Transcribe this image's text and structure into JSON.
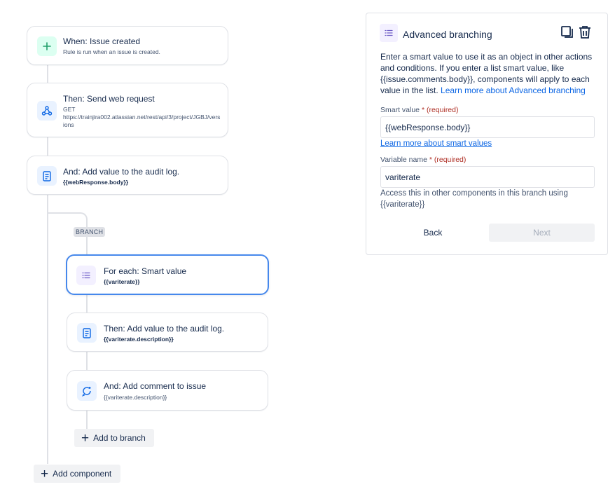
{
  "flow": {
    "trigger": {
      "title": "When: Issue created",
      "sub": "Rule is run when an issue is created."
    },
    "web_request": {
      "title": "Then: Send web request",
      "method": "GET",
      "url": "https://trainjira002.atlassian.net/rest/api/3/project/JGBJ/versions"
    },
    "audit_log": {
      "title": "And: Add value to the audit log.",
      "sub": "{{webResponse.body}}"
    },
    "branch_label": "BRANCH",
    "for_each": {
      "title": "For each: Smart value",
      "sub": "{{variterate}}"
    },
    "branch_audit": {
      "title": "Then: Add value to the audit log.",
      "sub": "{{variterate.description}}"
    },
    "branch_comment": {
      "title": "And: Add comment to issue",
      "sub": "{{variterate.description}}"
    },
    "add_to_branch": "Add to branch",
    "add_component": "Add component"
  },
  "panel": {
    "title": "Advanced branching",
    "desc_text": "Enter a smart value to use it as an object in other actions and conditions. If you enter a list smart value, like {{issue.comments.body}}, components will apply to each value in the list. ",
    "desc_link": "Learn more about Advanced branching",
    "smart_value_label": "Smart value",
    "smart_value_required": "(required)",
    "smart_value": "{{webResponse.body}}",
    "smart_values_link": "Learn more about smart values",
    "variable_name_label": "Variable name",
    "variable_name_required": "(required)",
    "variable_name": "variterate",
    "variable_help_line1": "Access this in other components in this branch using",
    "variable_help_line2": "{{variterate}}",
    "back_label": "Back",
    "next_label": "Next"
  },
  "colors": {
    "accent": "#0c66e4",
    "selected_border": "#4688ec",
    "required": "#ae2e24",
    "trigger_icon": "#22a06b"
  },
  "icons": {
    "trigger": "plus-icon",
    "web_request": "webhook-icon",
    "audit": "document-icon",
    "for_each": "list-icon",
    "comment": "comment-icon",
    "copy": "copy-icon",
    "delete": "trash-icon"
  }
}
